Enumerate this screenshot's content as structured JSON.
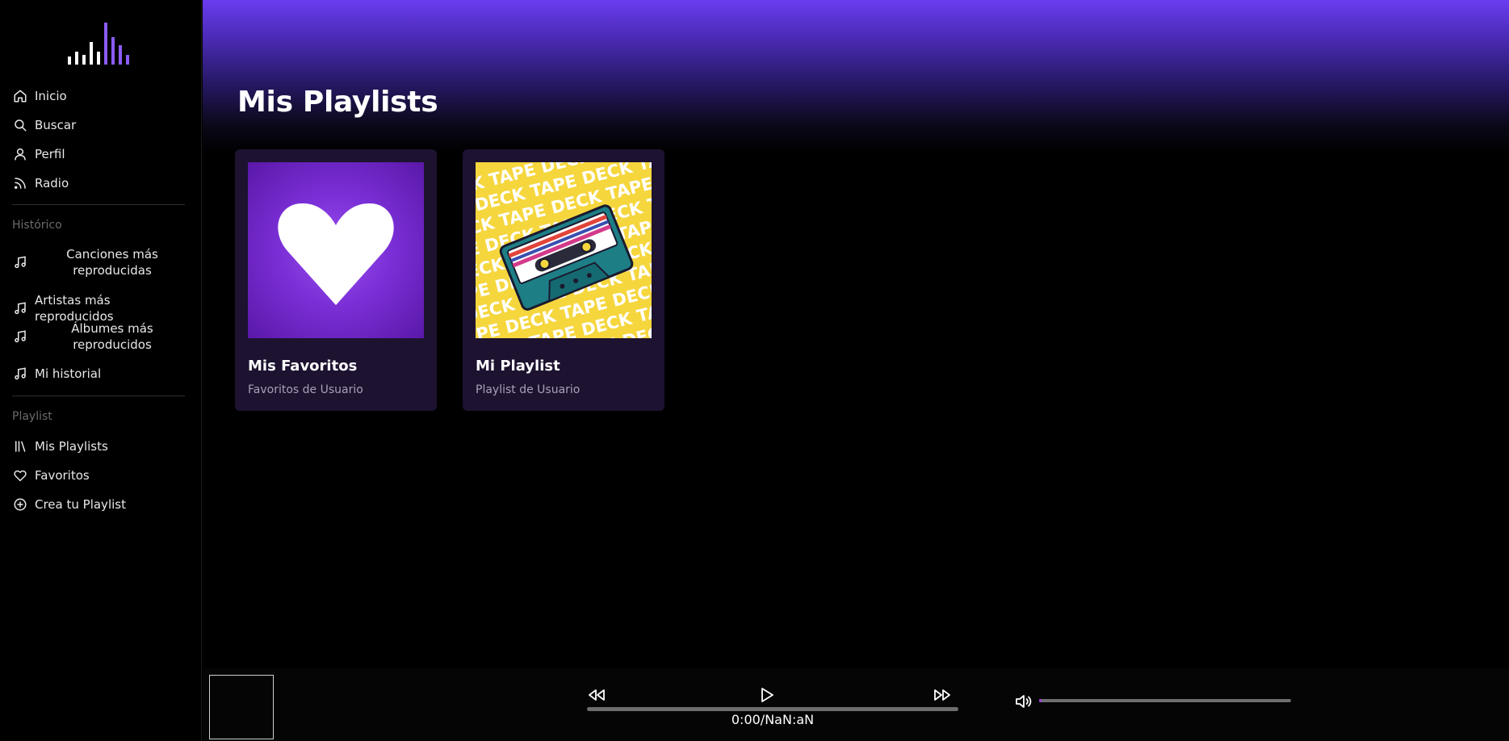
{
  "sidebar": {
    "nav": [
      {
        "label": "Inicio",
        "icon": "home-icon"
      },
      {
        "label": "Buscar",
        "icon": "search-icon"
      },
      {
        "label": "Perfil",
        "icon": "user-icon"
      },
      {
        "label": "Radio",
        "icon": "rss-icon"
      }
    ],
    "historico": {
      "title": "Histórico",
      "items": [
        {
          "label": "Canciones más reproducidas",
          "icon": "music-note-icon"
        },
        {
          "label": "Artistas más reproducidos",
          "icon": "music-note-icon"
        },
        {
          "label": "Álbumes más reproducidos",
          "icon": "music-note-icon"
        },
        {
          "label": "Mi historial",
          "icon": "music-note-icon"
        }
      ]
    },
    "playlist": {
      "title": "Playlist",
      "items": [
        {
          "label": "Mis Playlists",
          "icon": "library-icon"
        },
        {
          "label": "Favoritos",
          "icon": "heart-icon"
        },
        {
          "label": "Crea tu Playlist",
          "icon": "plus-circle-icon"
        }
      ]
    }
  },
  "main": {
    "title": "Mis Playlists",
    "cards": [
      {
        "name": "Mis Favoritos",
        "description": "Favoritos de Usuario"
      },
      {
        "name": "Mi Playlist",
        "description": "Playlist de Usuario"
      }
    ]
  },
  "player": {
    "time": "0:00/NaN:aN",
    "progress": 0,
    "volume": 0.01
  },
  "colors": {
    "accent": "#7b3ff2",
    "card_bg": "#1d1230",
    "volume_fill": "#a33ee0"
  }
}
